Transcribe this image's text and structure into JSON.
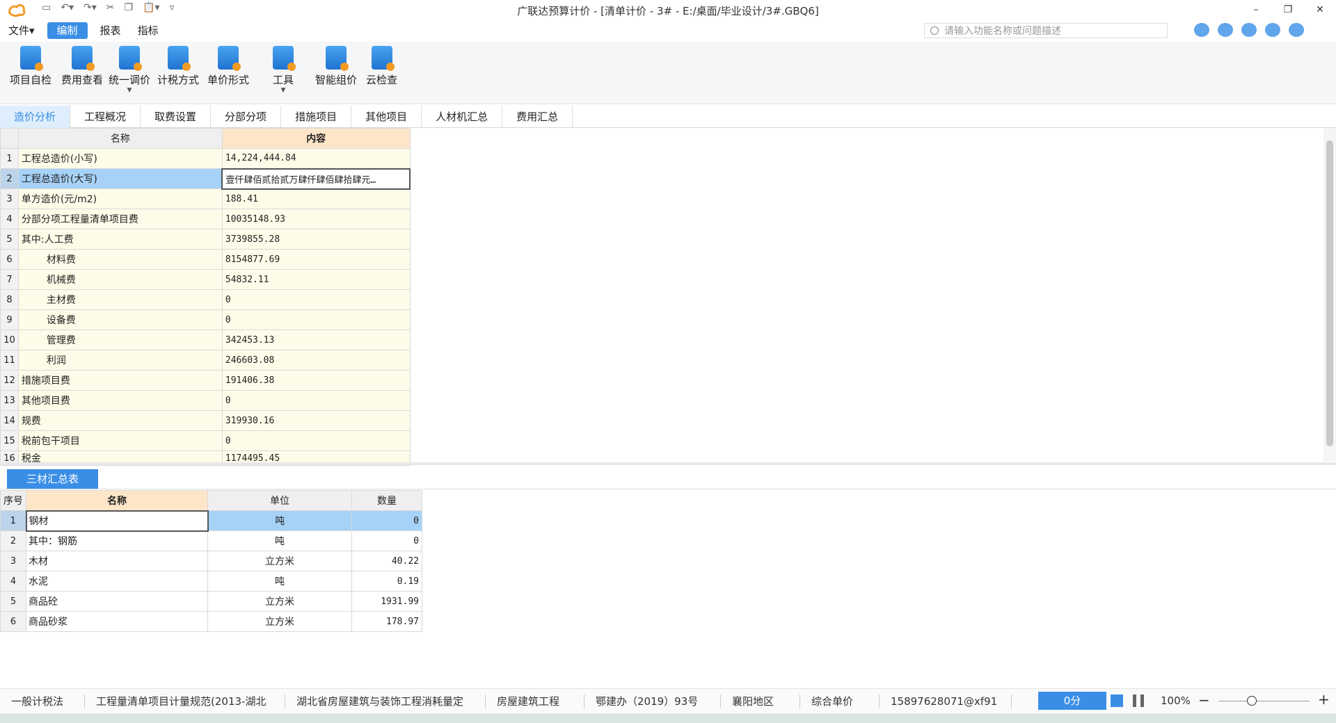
{
  "titlebar": {
    "title": "广联达预算计价 - [清单计价 - 3# - E:/桌面/毕业设计/3#.GBQ6]",
    "quick_access": [
      "save-icon",
      "undo-icon",
      "redo-icon",
      "cut-icon",
      "copy-icon",
      "paste-icon"
    ],
    "window_controls": [
      "–",
      "❐",
      "✕"
    ]
  },
  "menu": {
    "items": [
      "文件▾",
      "编制",
      "报表",
      "指标"
    ],
    "active": "编制"
  },
  "search": {
    "placeholder": "请输入功能名称或问题描述"
  },
  "ribbon": {
    "buttons": [
      {
        "label": "项目自检",
        "icon": "project-check-icon"
      },
      {
        "label": "费用查看",
        "icon": "fee-view-icon"
      },
      {
        "label": "统一调价",
        "icon": "unified-price-icon",
        "dropdown": true
      },
      {
        "label": "计税方式",
        "icon": "tax-method-icon"
      },
      {
        "label": "单价形式",
        "icon": "unit-price-form-icon"
      },
      {
        "label": "工具",
        "icon": "tools-icon",
        "dropdown": true
      },
      {
        "label": "智能组价",
        "icon": "smart-pricing-icon"
      },
      {
        "label": "云检查",
        "icon": "cloud-check-icon"
      }
    ]
  },
  "tabs": [
    "造价分析",
    "工程概况",
    "取费设置",
    "分部分项",
    "措施项目",
    "其他项目",
    "人材机汇总",
    "费用汇总"
  ],
  "active_tab": "造价分析",
  "cost_table": {
    "headers": [
      "名称",
      "内容"
    ],
    "rows": [
      {
        "no": "1",
        "name": "工程总造价(小写)",
        "value": "14,224,444.84"
      },
      {
        "no": "2",
        "name": "工程总造价(大写)",
        "value": "壹仟肆佰贰拾贰万肆仟肆佰肆拾肆元…"
      },
      {
        "no": "3",
        "name": "单方造价(元/m2)",
        "value": "188.41"
      },
      {
        "no": "4",
        "name": "分部分项工程量清单项目费",
        "value": "10035148.93"
      },
      {
        "no": "5",
        "name": "其中:人工费",
        "value": "3739855.28"
      },
      {
        "no": "6",
        "name": "材料费",
        "value": "8154877.69"
      },
      {
        "no": "7",
        "name": "机械费",
        "value": "54832.11"
      },
      {
        "no": "8",
        "name": "主材费",
        "value": "0"
      },
      {
        "no": "9",
        "name": "设备费",
        "value": "0"
      },
      {
        "no": "10",
        "name": "管理费",
        "value": "342453.13"
      },
      {
        "no": "11",
        "name": "利润",
        "value": "246603.08"
      },
      {
        "no": "12",
        "name": "措施项目费",
        "value": "191406.38"
      },
      {
        "no": "13",
        "name": "其他项目费",
        "value": "0"
      },
      {
        "no": "14",
        "name": "规费",
        "value": "319930.16"
      },
      {
        "no": "15",
        "name": "税前包干项目",
        "value": "0"
      },
      {
        "no": "16",
        "name": "税金",
        "value": "1174495.45"
      }
    ],
    "selected_row": "2"
  },
  "material_tab": "三材汇总表",
  "material_table": {
    "headers": [
      "序号",
      "名称",
      "单位",
      "数量"
    ],
    "rows": [
      {
        "no": "1",
        "name": "钢材",
        "unit": "吨",
        "qty": "0"
      },
      {
        "no": "2",
        "name": "其中：钢筋",
        "unit": "吨",
        "qty": "0"
      },
      {
        "no": "3",
        "name": "木材",
        "unit": "立方米",
        "qty": "40.22"
      },
      {
        "no": "4",
        "name": "水泥",
        "unit": "吨",
        "qty": "0.19"
      },
      {
        "no": "5",
        "name": "商品砼",
        "unit": "立方米",
        "qty": "1931.99"
      },
      {
        "no": "6",
        "name": "商品砂浆",
        "unit": "立方米",
        "qty": "178.97"
      }
    ],
    "selected_row": "1"
  },
  "status": {
    "items": [
      "一般计税法",
      "工程量清单项目计量规范(2013-湖北",
      "湖北省房屋建筑与装饰工程消耗量定",
      "房屋建筑工程",
      "鄂建办（2019）93号",
      "襄阳地区",
      "综合单价",
      "15897628071@xf91"
    ],
    "score": "0分",
    "zoom": "100%"
  }
}
